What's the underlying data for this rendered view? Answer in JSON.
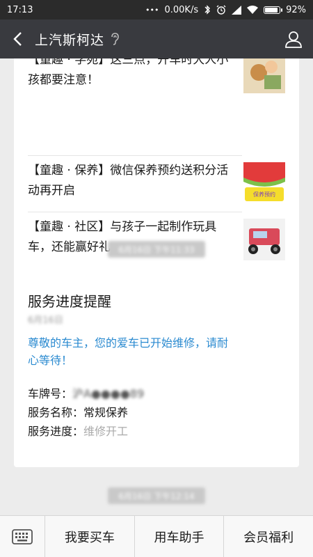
{
  "status_bar": {
    "time": "17:13",
    "dots": "•••",
    "network_speed": "0.00K/s",
    "battery_percent": "92%",
    "battery_level": 0.92
  },
  "header": {
    "title": "上汽斯柯达"
  },
  "articles": [
    {
      "text": "【童趣 · 学苑】这三点，开车时大人小孩都要注意！",
      "thumb_caption": ""
    },
    {
      "text": "【童趣 · 保养】微信保养预约送积分活动再开启",
      "thumb_caption": "保养预约"
    },
    {
      "text": "【童趣 · 社区】与孩子一起制作玩具车，还能赢好礼",
      "thumb_caption": ""
    }
  ],
  "timestamps": [
    "6月16日 下午11:33",
    "6月16日 下午12:14"
  ],
  "notice": {
    "title": "服务进度提醒",
    "date": "6月16日",
    "intro": "尊敬的车主，您的爱车已开始维修，请耐心等待！",
    "plate_label": "车牌号：",
    "plate_value": "沪A●●●●89",
    "service_label": "服务名称：",
    "service_value": "常规保养",
    "progress_label": "服务进度：",
    "progress_value": "维修开工"
  },
  "bottom_menu": {
    "items": [
      "我要买车",
      "用车助手",
      "会员福利"
    ]
  },
  "colors": {
    "status_bar": "#2b2b2b",
    "title_bar": "#393a3f",
    "chat_background": "#ececec",
    "link_blue": "#2a8ad0"
  },
  "icons": {
    "back": "back-arrow-icon",
    "ear": "ear-icon",
    "profile": "person-icon",
    "keyboard": "keyboard-icon"
  }
}
